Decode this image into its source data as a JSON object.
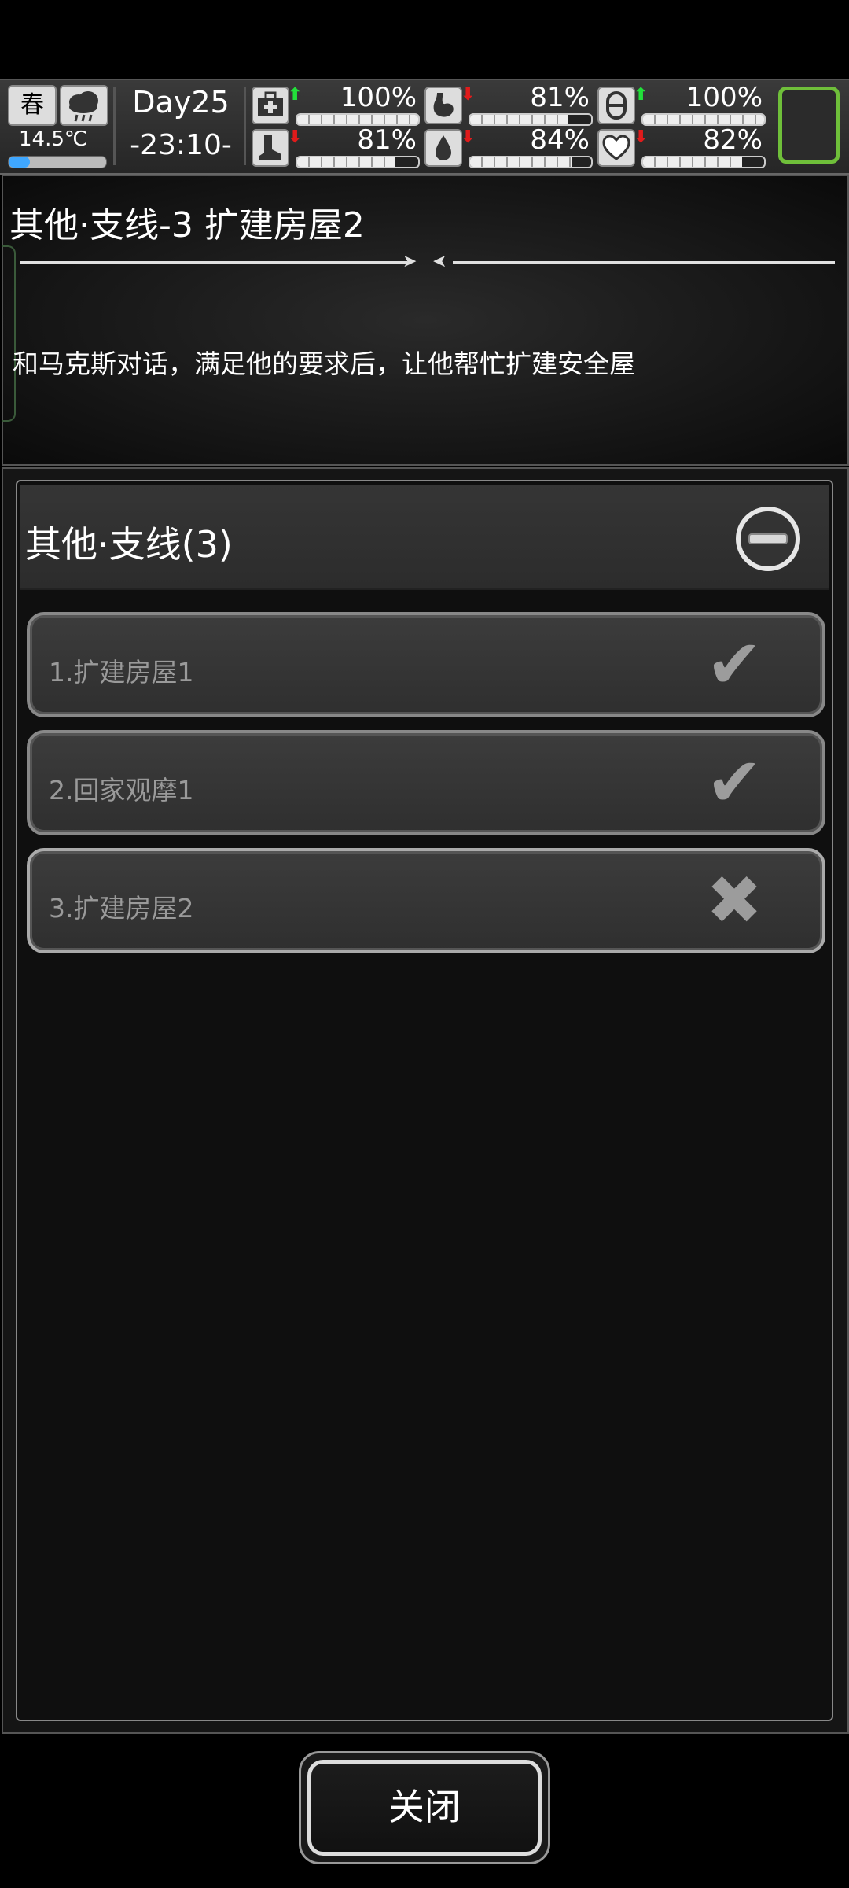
{
  "hud": {
    "season": "春",
    "weather_icon": "cloud-rain-icon",
    "temperature": "14.5℃",
    "temperature_level": 0.22,
    "day": "Day25",
    "time": "-23:10-",
    "stats": [
      {
        "name": "health",
        "icon": "medkit-icon",
        "trend": "up",
        "value": "100%",
        "level": 1.0
      },
      {
        "name": "hunger",
        "icon": "stomach-icon",
        "trend": "down",
        "value": "81%",
        "level": 0.81
      },
      {
        "name": "pill",
        "icon": "pill-icon",
        "trend": "up",
        "value": "100%",
        "level": 1.0
      },
      {
        "name": "stamina",
        "icon": "boot-icon",
        "trend": "down",
        "value": "81%",
        "level": 0.81
      },
      {
        "name": "thirst",
        "icon": "water-drop-icon",
        "trend": "down",
        "value": "84%",
        "level": 0.84
      },
      {
        "name": "mood",
        "icon": "heart-icon",
        "trend": "down",
        "value": "82%",
        "level": 0.82
      }
    ],
    "colors": {
      "up": "#22e03a",
      "down": "#e01b1b",
      "accent_box": "#6fbf3a"
    }
  },
  "detail": {
    "title": "其他·支线-3 扩建房屋2",
    "description": "和马克斯对话，满足他的要求后，让他帮忙扩建安全屋"
  },
  "list": {
    "category_title": "其他·支线(3)",
    "items": [
      {
        "label": "1.扩建房屋1",
        "status": "done",
        "mark": "✔"
      },
      {
        "label": "2.回家观摩1",
        "status": "done",
        "mark": "✔"
      },
      {
        "label": "3.扩建房屋2",
        "status": "incomplete",
        "mark": "✖"
      }
    ]
  },
  "footer": {
    "close_label": "关闭"
  }
}
